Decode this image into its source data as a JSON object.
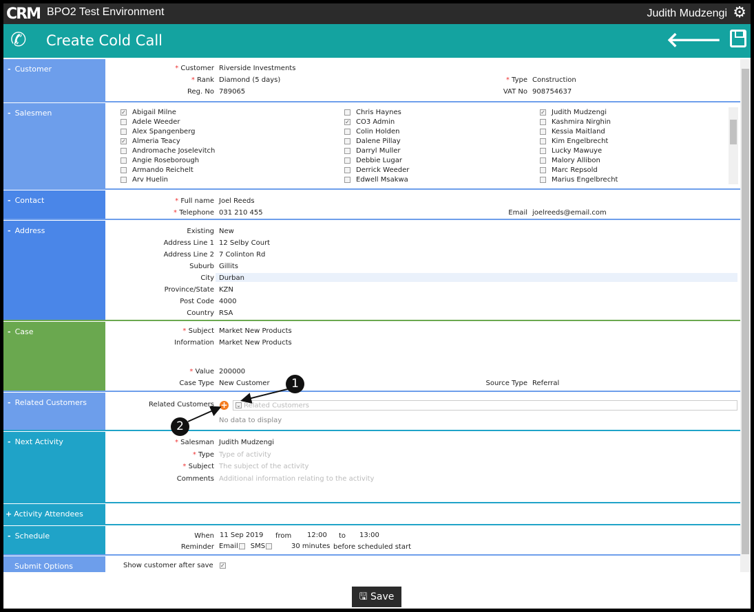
{
  "topbar": {
    "logo": "CRM",
    "environment": "BPO2 Test Environment",
    "user": "Judith Mudzengi",
    "settings_icon": "gear-icon"
  },
  "header": {
    "title": "Create Cold Call",
    "icon": "phone-icon",
    "back_icon": "arrow-left-icon",
    "save_icon": "floppy-disk-icon"
  },
  "colors": {
    "customer": "#6d9eeb",
    "contact": "#4a86e8",
    "case": "#6aa84f",
    "activity": "#1fa3c8",
    "header": "#14a3a0"
  },
  "customer": {
    "label": "Customer",
    "toggle": "-",
    "fields": {
      "customer_label": "Customer",
      "customer": "Riverside Investments",
      "rank_label": "Rank",
      "rank": "Diamond (5 days)",
      "regno_label": "Reg. No",
      "regno": "789065",
      "type_label": "Type",
      "type": "Construction",
      "vat_label": "VAT No",
      "vat": "908754637"
    }
  },
  "salesmen": {
    "label": "Salesmen",
    "toggle": "-",
    "columns": [
      [
        {
          "name": "Abigail Milne",
          "checked": true
        },
        {
          "name": "Adele Weeder",
          "checked": false
        },
        {
          "name": "Alex Spangenberg",
          "checked": false
        },
        {
          "name": "Almeria Teacy",
          "checked": true
        },
        {
          "name": "Andromache Joselevitch",
          "checked": false
        },
        {
          "name": "Angie Roseborough",
          "checked": false
        },
        {
          "name": "Armando Reichelt",
          "checked": false
        },
        {
          "name": "Arv Huelin",
          "checked": false
        }
      ],
      [
        {
          "name": "Chris Haynes",
          "checked": false
        },
        {
          "name": "CO3 Admin",
          "checked": true
        },
        {
          "name": "Colin Holden",
          "checked": false
        },
        {
          "name": "Dalene Pillay",
          "checked": false
        },
        {
          "name": "Darryl Muller",
          "checked": false
        },
        {
          "name": "Debbie Lugar",
          "checked": false
        },
        {
          "name": "Derrick Weeder",
          "checked": false
        },
        {
          "name": "Edwell Msakwa",
          "checked": false
        }
      ],
      [
        {
          "name": "Judith Mudzengi",
          "checked": true
        },
        {
          "name": "Kashmira Nirghin",
          "checked": false
        },
        {
          "name": "Kessia Maitland",
          "checked": false
        },
        {
          "name": "Kim Engelbrecht",
          "checked": false
        },
        {
          "name": "Lucky Mawuye",
          "checked": false
        },
        {
          "name": "Malory Allibon",
          "checked": false
        },
        {
          "name": "Marc Repsold",
          "checked": false
        },
        {
          "name": "Marius Engelbrecht",
          "checked": false
        }
      ]
    ]
  },
  "contact": {
    "label": "Contact",
    "toggle": "-",
    "fullname_label": "Full name",
    "fullname": "Joel Reeds",
    "tel_label": "Telephone",
    "tel": "031 210 455",
    "email_label": "Email",
    "email": "joelreeds@email.com"
  },
  "address": {
    "label": "Address",
    "toggle": "-",
    "rows": [
      {
        "l": "Existing",
        "v": "New"
      },
      {
        "l": "Address Line 1",
        "v": "12 Selby Court"
      },
      {
        "l": "Address Line 2",
        "v": "7 Colinton Rd"
      },
      {
        "l": "Suburb",
        "v": "Gillits"
      },
      {
        "l": "City",
        "v": "Durban"
      },
      {
        "l": "Province/State",
        "v": "KZN"
      },
      {
        "l": "Post Code",
        "v": "4000"
      },
      {
        "l": "Country",
        "v": "RSA"
      }
    ]
  },
  "case": {
    "label": "Case",
    "toggle": "-",
    "subject_label": "Subject",
    "subject": "Market New Products",
    "info_label": "Information",
    "info": "Market New Products",
    "value_label": "Value",
    "value": "200000",
    "casetype_label": "Case Type",
    "casetype": "New Customer",
    "source_label": "Source Type",
    "source": "Referral"
  },
  "related": {
    "label": "Related Customers",
    "toggle": "-",
    "field_label": "Related Customers",
    "placeholder": "Related Customers",
    "empty": "No data to display"
  },
  "next": {
    "label": "Next Activity",
    "toggle": "-",
    "salesman_label": "Salesman",
    "salesman": "Judith Mudzengi",
    "type_label": "Type",
    "type_ph": "Type of activity",
    "subject_label": "Subject",
    "subject_ph": "The subject of the activity",
    "comments_label": "Comments",
    "comments_ph": "Additional information relating to the activity"
  },
  "attendees": {
    "label": "Activity Attendees",
    "toggle": "+"
  },
  "schedule": {
    "label": "Schedule",
    "toggle": "-",
    "when_label": "When",
    "date": "11 Sep 2019",
    "from": "from",
    "start": "12:00",
    "to": "to",
    "end": "13:00",
    "reminder_label": "Reminder",
    "email": "Email",
    "email_checked": false,
    "sms": "SMS",
    "sms_checked": false,
    "minutes": "30 minutes",
    "before": "before scheduled start"
  },
  "submit": {
    "label": "Submit Options",
    "show_label": "Show customer after save",
    "show_checked": true
  },
  "save_button": "Save",
  "callouts": [
    "1",
    "2"
  ]
}
